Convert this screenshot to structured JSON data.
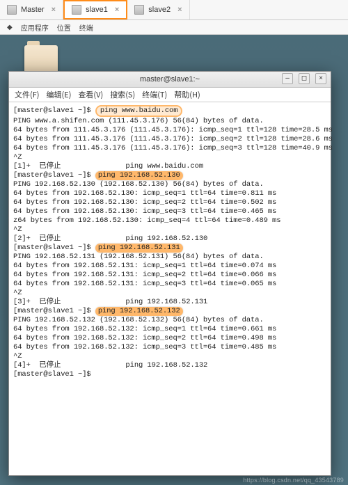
{
  "tabs": [
    {
      "label": "Master"
    },
    {
      "label": "slave1"
    },
    {
      "label": "slave2"
    }
  ],
  "topmenu": {
    "apps": "应用程序",
    "loc": "位置",
    "term": "终端"
  },
  "win": {
    "title": "master@slave1:~",
    "menu": {
      "file": "文件(F)",
      "edit": "编辑(E)",
      "view": "查看(V)",
      "search": "搜索(S)",
      "term": "终端(T)",
      "help": "帮助(H)"
    }
  },
  "cmd": {
    "prompt": "[master@slave1 ~]$",
    "ping": "ping",
    "baidu": "www.baidu.com",
    "ip130": "192.168.52.130",
    "ip131": "192.168.52.131",
    "ip132": "192.168.52.132"
  },
  "out": {
    "baidu_hdr": "PING www.a.shifen.com (111.45.3.176) 56(84) bytes of data.",
    "b1": "64 bytes from 111.45.3.176 (111.45.3.176): icmp_seq=1 ttl=128 time=28.5 ms",
    "b2": "64 bytes from 111.45.3.176 (111.45.3.176): icmp_seq=2 ttl=128 time=28.6 ms",
    "b3": "64 bytes from 111.45.3.176 (111.45.3.176): icmp_seq=3 ttl=128 time=40.9 ms",
    "cz": "^Z",
    "stop1": "[1]+  已停止               ping www.baidu.com",
    "h130": "PING 192.168.52.130 (192.168.52.130) 56(84) bytes of data.",
    "r130_1": "64 bytes from 192.168.52.130: icmp_seq=1 ttl=64 time=0.811 ms",
    "r130_2": "64 bytes from 192.168.52.130: icmp_seq=2 ttl=64 time=0.502 ms",
    "r130_3": "64 bytes from 192.168.52.130: icmp_seq=3 ttl=64 time=0.465 ms",
    "r130_4": "z64 bytes from 192.168.52.130: icmp_seq=4 ttl=64 time=0.489 ms",
    "stop2": "[2]+  已停止               ping 192.168.52.130",
    "h131": "PING 192.168.52.131 (192.168.52.131) 56(84) bytes of data.",
    "r131_1": "64 bytes from 192.168.52.131: icmp_seq=1 ttl=64 time=0.074 ms",
    "r131_2": "64 bytes from 192.168.52.131: icmp_seq=2 ttl=64 time=0.066 ms",
    "r131_3": "64 bytes from 192.168.52.131: icmp_seq=3 ttl=64 time=0.065 ms",
    "stop3": "[3]+  已停止               ping 192.168.52.131",
    "h132": "PING 192.168.52.132 (192.168.52.132) 56(84) bytes of data.",
    "r132_1": "64 bytes from 192.168.52.132: icmp_seq=1 ttl=64 time=0.661 ms",
    "r132_2": "64 bytes from 192.168.52.132: icmp_seq=2 ttl=64 time=0.498 ms",
    "r132_3": "64 bytes from 192.168.52.132: icmp_seq=3 ttl=64 time=0.485 ms",
    "stop4": "[4]+  已停止               ping 192.168.52.132"
  },
  "watermark": "https://blog.csdn.net/qq_43543789"
}
